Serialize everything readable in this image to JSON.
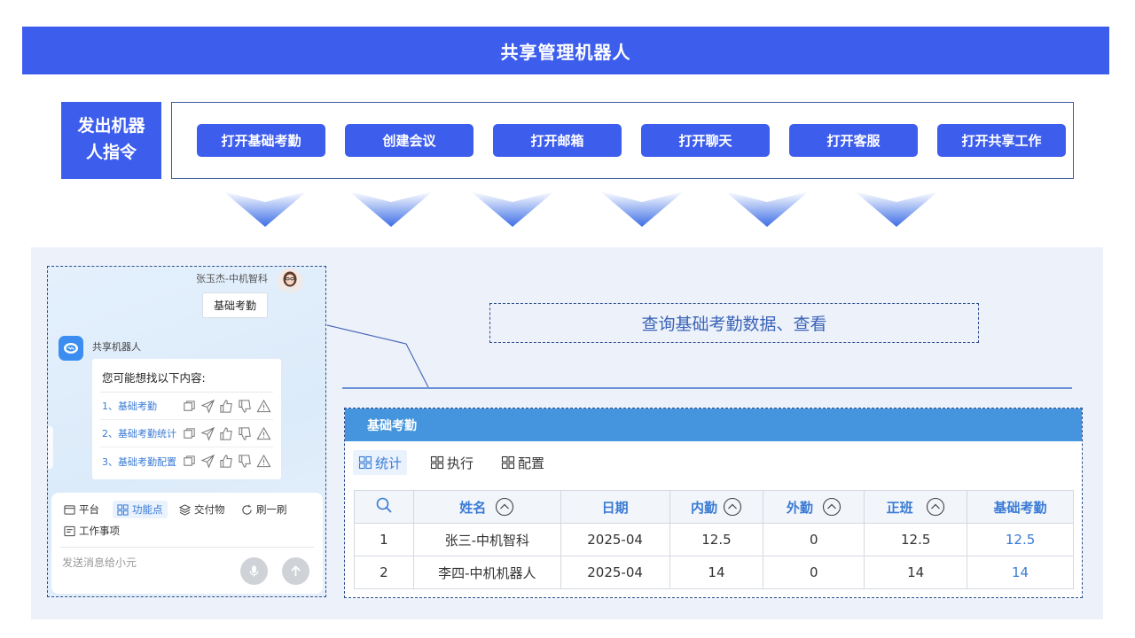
{
  "header": {
    "title": "共享管理机器人"
  },
  "commands": {
    "label": "发出机器人指令",
    "label_line1": "发出机器",
    "label_line2": "人指令",
    "buttons": [
      "打开基础考勤",
      "创建会议",
      "打开邮箱",
      "打开聊天",
      "打开客服",
      "打开共享工作"
    ]
  },
  "chat": {
    "user_name": "张玉杰-中机智科",
    "user_message": "基础考勤",
    "bot_name": "共享机器人",
    "bot_intro": "您可能想找以下内容:",
    "suggestions": [
      "1、基础考勤",
      "2、基础考勤统计",
      "3、基础考勤配置"
    ],
    "composer": {
      "chips": [
        "平台",
        "功能点",
        "交付物",
        "刷一刷",
        "工作事项"
      ],
      "placeholder": "发送消息给小元"
    }
  },
  "description": "查询基础考勤数据、查看",
  "panel": {
    "title": "基础考勤",
    "tabs": [
      "统计",
      "执行",
      "配置"
    ],
    "table": {
      "columns": [
        "",
        "姓名",
        "日期",
        "内勤",
        "外勤",
        "正班",
        "基础考勤"
      ],
      "rows": [
        [
          "1",
          "张三-中机智科",
          "2025-04",
          "12.5",
          "0",
          "12.5",
          "12.5"
        ],
        [
          "2",
          "李四-中机机器人",
          "2025-04",
          "14",
          "0",
          "14",
          "14"
        ]
      ]
    }
  },
  "colors": {
    "brand_blue": "#3d5ded",
    "panel_header": "#4495dd",
    "link_blue": "#3a7bd5",
    "workspace_bg": "#edf2fa"
  }
}
